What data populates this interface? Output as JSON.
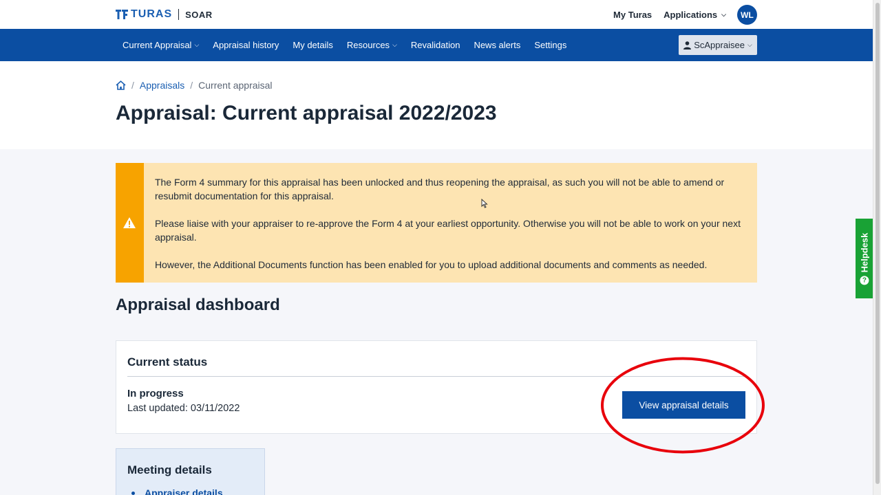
{
  "brand": {
    "name": "TURAS",
    "product": "SOAR"
  },
  "top_links": {
    "my_turas": "My Turas",
    "applications": "Applications",
    "avatar_initials": "WL"
  },
  "nav": {
    "items": [
      {
        "label": "Current Appraisal",
        "dropdown": true
      },
      {
        "label": "Appraisal history",
        "dropdown": false
      },
      {
        "label": "My details",
        "dropdown": false
      },
      {
        "label": "Resources",
        "dropdown": true
      },
      {
        "label": "Revalidation",
        "dropdown": false
      },
      {
        "label": "News alerts",
        "dropdown": false
      },
      {
        "label": "Settings",
        "dropdown": false
      }
    ],
    "role": "ScAppraisee"
  },
  "breadcrumb": {
    "home_icon": "home-icon",
    "appraisals": "Appraisals",
    "current": "Current appraisal"
  },
  "page_title": "Appraisal: Current appraisal 2022/2023",
  "alert": {
    "icon": "warning-icon",
    "paragraphs": [
      "The Form 4 summary for this appraisal has been unlocked and thus reopening the appraisal, as such you will not be able to amend or resubmit documentation for this appraisal.",
      "Please liaise with your appraiser to re-approve the Form 4 at your earliest opportunity. Otherwise you will not be able to work on your next appraisal.",
      "However, the Additional Documents function has been enabled for you to upload additional documents and comments as needed."
    ]
  },
  "dashboard": {
    "title": "Appraisal dashboard",
    "status_card": {
      "title": "Current status",
      "status": "In progress",
      "last_updated": "Last updated: 03/11/2022",
      "button": "View appraisal details"
    },
    "meeting_card": {
      "title": "Meeting details",
      "link": "Appraiser details"
    }
  },
  "helpdesk": {
    "label": "Helpdesk",
    "icon": "question-icon"
  },
  "colors": {
    "primary": "#0b4ea2",
    "alert_bg": "#fde4b2",
    "alert_accent": "#f7a300",
    "helpdesk": "#19a235",
    "highlight": "#e8000b"
  }
}
